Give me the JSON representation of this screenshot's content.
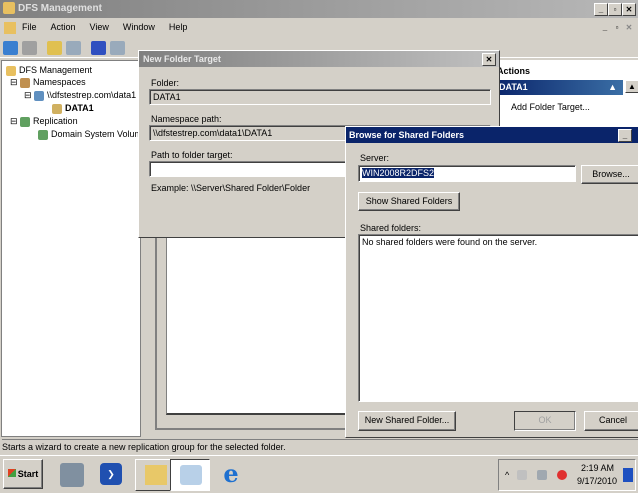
{
  "window": {
    "title": "DFS Management"
  },
  "menu": [
    "File",
    "Action",
    "View",
    "Window",
    "Help"
  ],
  "tree": {
    "root": "DFS Management",
    "namespaces": "Namespaces",
    "namespace": "\\\\dfstestrep.com\\data1",
    "folder": "DATA1",
    "replication": "Replication",
    "dsv": "Domain System Volume"
  },
  "actions": {
    "header": "Actions",
    "section": "DATA1",
    "item1": "Add Folder Target..."
  },
  "new_folder_target": {
    "title": "New Folder Target",
    "folder_label": "Folder:",
    "folder_value": "DATA1",
    "ns_label": "Namespace path:",
    "ns_value": "\\\\dfstestrep.com\\data1\\DATA1",
    "path_label": "Path to folder target:",
    "path_value": "",
    "example": "Example: \\\\Server\\Shared Folder\\Folder"
  },
  "browse": {
    "title": "Browse for Shared Folders",
    "server_label": "Server:",
    "server_value": "WIN2008R2DFS2",
    "browse_btn": "Browse...",
    "show_btn": "Show Shared Folders",
    "shared_label": "Shared folders:",
    "shared_empty": "No shared folders were found on the server.",
    "new_btn": "New Shared Folder...",
    "ok_btn": "OK",
    "cancel_btn": "Cancel"
  },
  "status": "Starts a wizard to create a new replication group for the selected folder.",
  "taskbar": {
    "start": "Start",
    "time": "2:19 AM",
    "date": "9/17/2010"
  }
}
